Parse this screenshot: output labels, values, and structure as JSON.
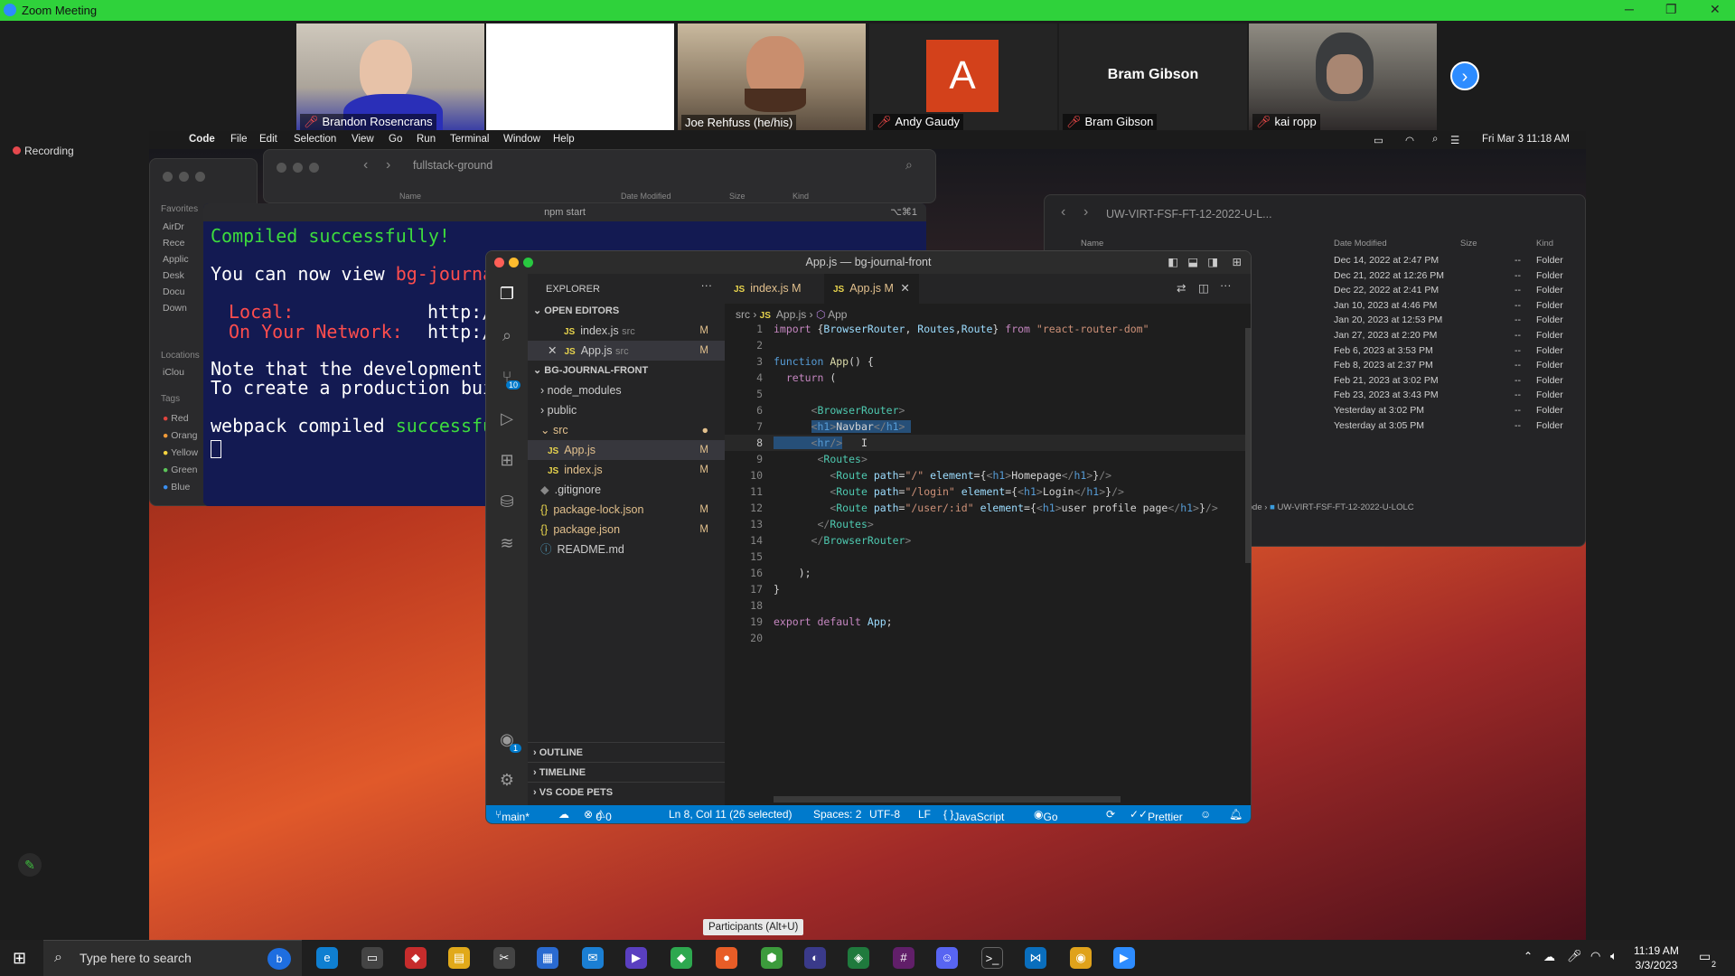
{
  "zoom": {
    "title": "Zoom Meeting",
    "recording": "Recording",
    "participants_tooltip": "Participants (Alt+U)",
    "participants": [
      {
        "name": "Brandon Rosencrans"
      },
      {
        "name": ""
      },
      {
        "name": "Joe Rehfuss (he/his)"
      },
      {
        "name": "Andy Gaudy",
        "initial": "A"
      },
      {
        "name": "Bram Gibson",
        "label": "Bram Gibson"
      },
      {
        "name": "kai ropp"
      }
    ]
  },
  "mac_menu": {
    "app": "Code",
    "items": [
      "File",
      "Edit",
      "Selection",
      "View",
      "Go",
      "Run",
      "Terminal",
      "Window",
      "Help"
    ],
    "clock": "Fri Mar 3  11:18 AM"
  },
  "finder_back": {
    "title": "fullstack-ground",
    "sidebar_favorites": "Favorites",
    "favs": [
      "AirDr",
      "Rece",
      "Applic",
      "Desk",
      "Docu",
      "Down"
    ],
    "locations": "Locations",
    "icloud": "iClou",
    "tags": "Tags",
    "tag_items": [
      {
        "label": "Red",
        "color": "#e0443e"
      },
      {
        "label": "Orang",
        "color": "#f09a38"
      },
      {
        "label": "Yellow",
        "color": "#f5d33f"
      },
      {
        "label": "Green",
        "color": "#5cc45a"
      },
      {
        "label": "Blue",
        "color": "#3a8ef0"
      }
    ],
    "columns": [
      "Name",
      "Date Modified",
      "Size",
      "Kind"
    ]
  },
  "finder_right": {
    "title": "UW-VIRT-FSF-FT-12-2022-U-L...",
    "columns": [
      "Name",
      "Date Modified",
      "Size",
      "Kind"
    ],
    "rows": [
      {
        "date": "Dec 14, 2022 at 2:47 PM",
        "size": "--",
        "kind": "Folder"
      },
      {
        "date": "Dec 21, 2022 at 12:26 PM",
        "size": "--",
        "kind": "Folder"
      },
      {
        "date": "Dec 22, 2022 at 2:41 PM",
        "size": "--",
        "kind": "Folder"
      },
      {
        "date": "Jan 10, 2023 at 4:46 PM",
        "size": "--",
        "kind": "Folder"
      },
      {
        "date": "Jan 20, 2023 at 12:53 PM",
        "size": "--",
        "kind": "Folder"
      },
      {
        "date": "Jan 27, 2023 at 2:20 PM",
        "size": "--",
        "kind": "Folder"
      },
      {
        "date": "Feb 6, 2023 at 3:53 PM",
        "size": "--",
        "kind": "Folder"
      },
      {
        "date": "Feb 8, 2023 at 2:37 PM",
        "size": "--",
        "kind": "Folder"
      },
      {
        "date": "Feb 21, 2023 at 3:02 PM",
        "size": "--",
        "kind": "Folder"
      },
      {
        "date": "Feb 23, 2023 at 3:43 PM",
        "size": "--",
        "kind": "Folder"
      },
      {
        "date": "Yesterday at 3:02 PM",
        "size": "--",
        "kind": "Folder"
      },
      {
        "date": "Yesterday at 3:05 PM",
        "size": "--",
        "kind": "Folder"
      }
    ],
    "path_prefix": "code",
    "path": "UW-VIRT-FSF-FT-12-2022-U-LOLC"
  },
  "terminal": {
    "title": "npm start",
    "shortcut": "⌥⌘1",
    "line1": "Compiled successfully!",
    "line2a": "You can now view ",
    "line2b": "bg-journa",
    "local_label": "Local:",
    "local_val": "http:/",
    "network_label": "On Your Network:",
    "network_val": "http:/",
    "note1": "Note that the development ",
    "note2": "To create a production bui",
    "wp_a": "webpack compiled ",
    "wp_b": "successfu"
  },
  "vscode": {
    "title": "App.js — bg-journal-front",
    "explorer": "EXPLORER",
    "open_editors": "OPEN EDITORS",
    "open_files": [
      {
        "name": "index.js",
        "dir": "src",
        "badge": "M"
      },
      {
        "name": "App.js",
        "dir": "src",
        "badge": "M"
      }
    ],
    "project": "BG-JOURNAL-FRONT",
    "tree": [
      {
        "name": "node_modules",
        "kind": "folder"
      },
      {
        "name": "public",
        "kind": "folder"
      },
      {
        "name": "src",
        "kind": "folder-open"
      },
      {
        "name": "App.js",
        "kind": "js",
        "badge": "M"
      },
      {
        "name": "index.js",
        "kind": "js",
        "badge": "M"
      },
      {
        "name": ".gitignore",
        "kind": "file"
      },
      {
        "name": "package-lock.json",
        "kind": "json",
        "badge": "M"
      },
      {
        "name": "package.json",
        "kind": "json",
        "badge": "M"
      },
      {
        "name": "README.md",
        "kind": "info"
      }
    ],
    "bottom_panels": [
      "OUTLINE",
      "TIMELINE",
      "VS CODE PETS"
    ],
    "tabs": [
      {
        "name": "index.js",
        "badge": "M"
      },
      {
        "name": "App.js",
        "badge": "M"
      }
    ],
    "breadcrumb": [
      "src",
      "App.js",
      "App"
    ],
    "accounts_badge": "1",
    "scm_badge": "10",
    "status": {
      "branch": "main*",
      "errors": "0",
      "warnings": "0",
      "cursor": "Ln 8, Col 11 (26 selected)",
      "spaces": "Spaces: 2",
      "encoding": "UTF-8",
      "eol": "LF",
      "language": "JavaScript",
      "golive": "Go Live",
      "prettier": "Prettier"
    }
  },
  "taskbar": {
    "search_placeholder": "Type here to search",
    "time": "11:19 AM",
    "date": "3/3/2023",
    "notif": "2"
  }
}
